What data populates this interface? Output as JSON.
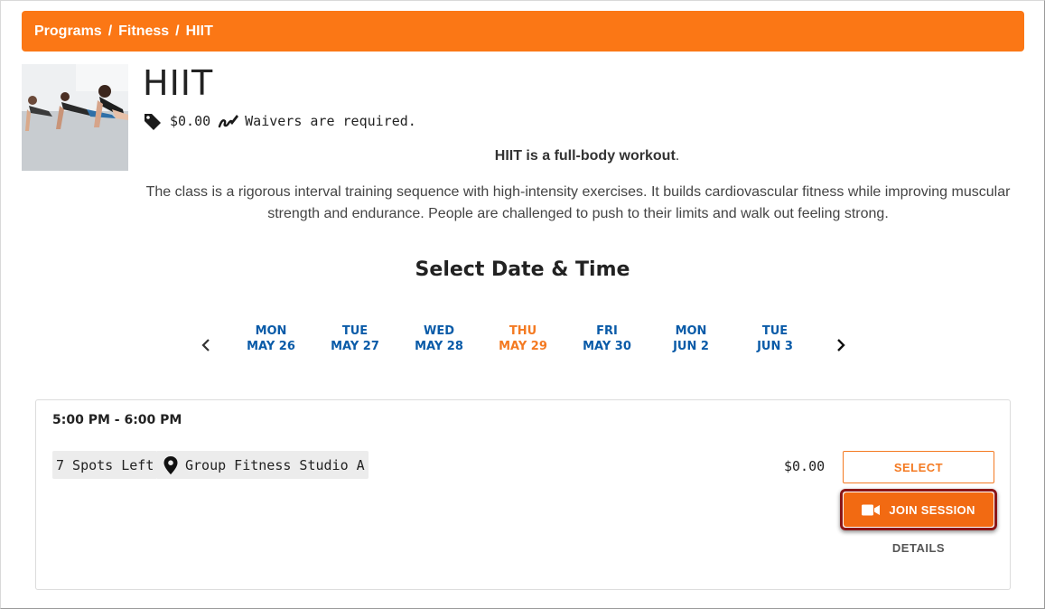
{
  "breadcrumb": {
    "items": [
      "Programs",
      "Fitness",
      "HIIT"
    ],
    "separator": "/"
  },
  "program": {
    "title": "HIIT",
    "price": "$0.00",
    "waiver_text": "Waivers are required.",
    "tagline_bold": "HIIT is a full-body workout",
    "tagline_end": ".",
    "description": "The class is a rigorous interval training sequence with high-intensity exercises. It builds cardiovascular fitness while improving muscular strength and endurance. People are challenged to push to their limits and walk out feeling strong."
  },
  "schedule": {
    "heading": "Select Date & Time",
    "days": [
      {
        "dow": "MON",
        "date": "MAY 26"
      },
      {
        "dow": "TUE",
        "date": "MAY 27"
      },
      {
        "dow": "WED",
        "date": "MAY 28"
      },
      {
        "dow": "THU",
        "date": "MAY 29"
      },
      {
        "dow": "FRI",
        "date": "MAY 30"
      },
      {
        "dow": "MON",
        "date": "JUN 2"
      },
      {
        "dow": "TUE",
        "date": "JUN 3"
      }
    ],
    "selected_day": "THU MAY 29"
  },
  "session": {
    "time": "5:00 PM - 6:00 PM",
    "spots": "7 Spots Left",
    "location": "Group Fitness Studio A",
    "price": "$0.00",
    "select_label": "SELECT",
    "join_label": "JOIN SESSION",
    "details_label": "DETAILS"
  },
  "colors": {
    "brand_orange": "#fb7715",
    "date_blue": "#0a5ba8",
    "selected_date": "#f47a22",
    "join_highlight": "#8b1616"
  },
  "icons": [
    "price-tag-icon",
    "signature-icon",
    "map-pin-icon",
    "video-camera-icon",
    "chevron-left-icon",
    "chevron-right-icon"
  ]
}
